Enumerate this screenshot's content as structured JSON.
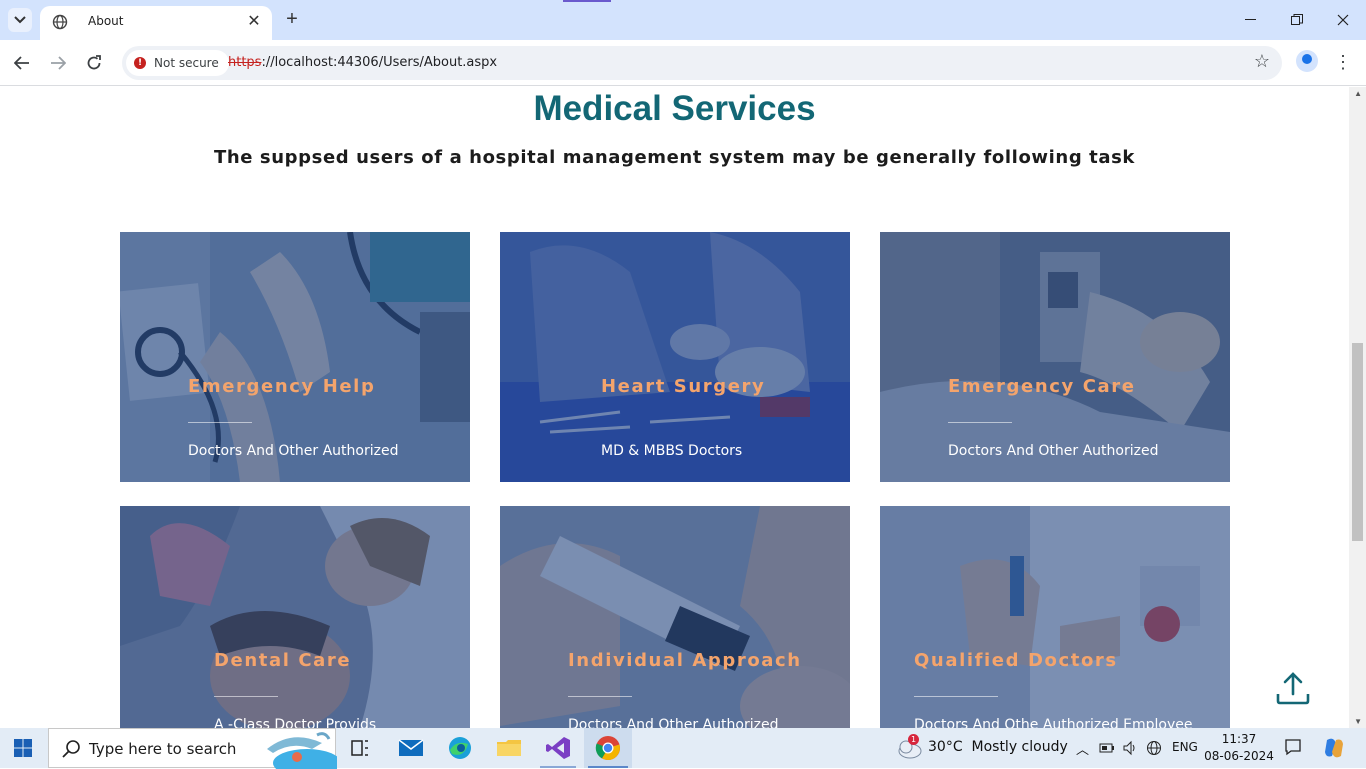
{
  "browser": {
    "tab_title": "About",
    "security_label": "Not secure",
    "url_scheme": "https",
    "url_rest": "://localhost:44306/Users/About.aspx"
  },
  "page": {
    "heading": "Medical Services",
    "subheading": "The suppsed users of a hospital management system may be generally following task",
    "services": [
      {
        "title": "Emergency Help",
        "subtitle": "Doctors And Other Authorized"
      },
      {
        "title": "Heart Surgery",
        "subtitle": "MD & MBBS Doctors"
      },
      {
        "title": "Emergency Care",
        "subtitle": "Doctors And Other Authorized"
      },
      {
        "title": "Dental Care",
        "subtitle": "A -Class Doctor Provids"
      },
      {
        "title": "Individual Approach",
        "subtitle": "Doctors And Other Authorized"
      },
      {
        "title": "Qualified Doctors",
        "subtitle": "Doctors And Othe Authorized Employee"
      }
    ]
  },
  "taskbar": {
    "search_placeholder": "Type here to search",
    "weather_temp": "30°C",
    "weather_desc": "Mostly cloudy",
    "weather_badge": "1",
    "language": "ENG",
    "time": "11:37",
    "date": "08-06-2024"
  },
  "colors": {
    "heading": "#136775",
    "card_title": "#f4a46c",
    "card_overlay": "#244682"
  }
}
